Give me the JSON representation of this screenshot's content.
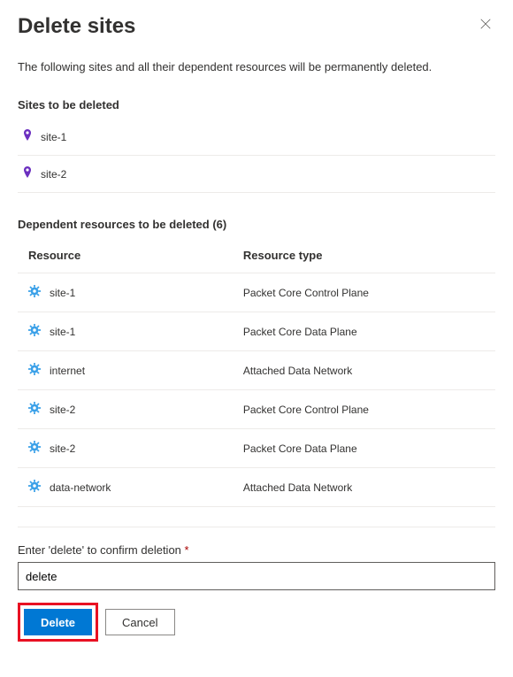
{
  "header": {
    "title": "Delete sites"
  },
  "description": "The following sites and all their dependent resources will be permanently deleted.",
  "sites_section": {
    "title": "Sites to be deleted",
    "items": [
      {
        "name": "site-1"
      },
      {
        "name": "site-2"
      }
    ]
  },
  "dependent_section": {
    "title": "Dependent resources to be deleted (6)",
    "columns": {
      "resource": "Resource",
      "type": "Resource type"
    },
    "rows": [
      {
        "name": "site-1",
        "type": "Packet Core Control Plane"
      },
      {
        "name": "site-1",
        "type": "Packet Core Data Plane"
      },
      {
        "name": "internet",
        "type": "Attached Data Network"
      },
      {
        "name": "site-2",
        "type": "Packet Core Control Plane"
      },
      {
        "name": "site-2",
        "type": "Packet Core Data Plane"
      },
      {
        "name": "data-network",
        "type": "Attached Data Network"
      }
    ]
  },
  "confirm": {
    "label": "Enter 'delete' to confirm deletion",
    "required_marker": "*",
    "value": "delete"
  },
  "buttons": {
    "delete": "Delete",
    "cancel": "Cancel"
  },
  "colors": {
    "pin": "#6b2fbf",
    "gear": "#3aa0e8",
    "primary": "#0078d4",
    "highlight": "#e81123"
  }
}
